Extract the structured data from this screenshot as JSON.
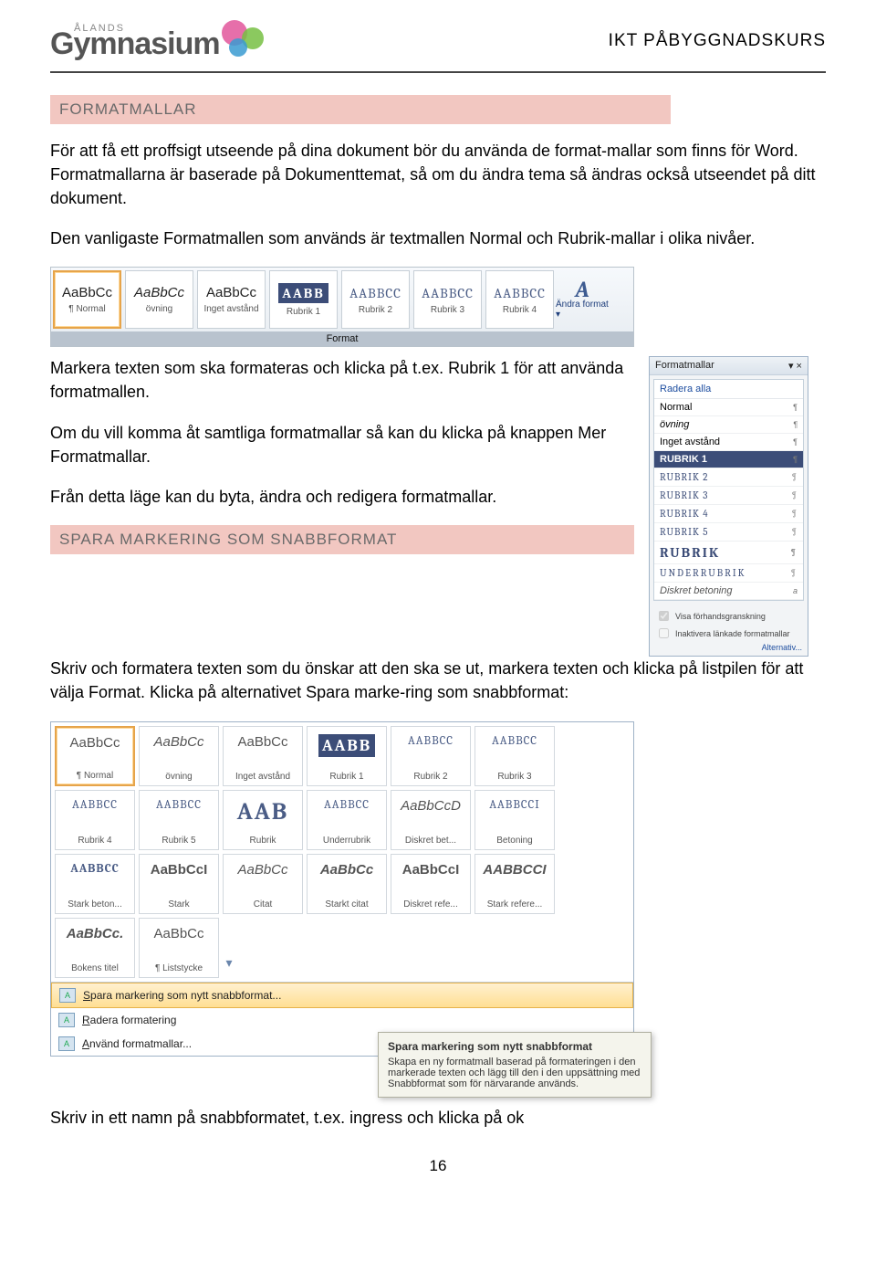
{
  "header": {
    "brand_top": "ÅLANDS",
    "brand": "Gymnasium",
    "course_title": "IKT PÅBYGGNADSKURS"
  },
  "sections": {
    "heading1": "FORMATMALLAR",
    "para1": "För att få ett proffsigt utseende på dina dokument bör du använda de format-mallar som finns för Word. Formatmallarna är baserade på Dokumenttemat, så om du ändra tema så ändras också utseendet på ditt dokument.",
    "para2": "Den vanligaste Formatmallen som används är textmallen Normal och Rubrik-mallar i olika nivåer.",
    "para3": "Markera texten som ska formateras och klicka på t.ex. Rubrik 1 för att använda formatmallen.",
    "para4": "Om du vill komma åt samtliga formatmallar så kan du klicka på knappen Mer Formatmallar.",
    "para5": "Från detta läge kan du byta, ändra och redigera formatmallar.",
    "heading2": "SPARA MARKERING SOM SNABBFORMAT",
    "para6": "Skriv och formatera texten som du önskar att den ska se ut, markera texten och klicka på listpilen för att välja Format. Klicka på alternativet Spara marke-ring som snabbformat:",
    "para7": "Skriv in ett namn på snabbformatet, t.ex. ingress och klicka på ok"
  },
  "ribbon": {
    "tiles": [
      {
        "sample": "AaBbCc",
        "label": "¶ Normal",
        "class": ""
      },
      {
        "sample": "AaBbCc",
        "label": "övning",
        "class": "italic"
      },
      {
        "sample": "AaBbCc",
        "label": "Inget avstånd",
        "class": ""
      },
      {
        "sample": "AABB",
        "label": "Rubrik 1",
        "class": "rubrik1"
      },
      {
        "sample": "AABBCC",
        "label": "Rubrik 2",
        "class": "rubrik"
      },
      {
        "sample": "AABBCC",
        "label": "Rubrik 3",
        "class": "rubrik"
      },
      {
        "sample": "AABBCC",
        "label": "Rubrik 4",
        "class": "rubrik"
      }
    ],
    "change_format": "Ändra format ▾",
    "footer": "Format"
  },
  "pane": {
    "title": "Formatmallar",
    "clear": "Radera alla",
    "items": [
      {
        "label": "Normal",
        "class": "",
        "mark": "¶"
      },
      {
        "label": "övning",
        "class": "italic",
        "mark": "¶"
      },
      {
        "label": "Inget avstånd",
        "class": "",
        "mark": "¶"
      },
      {
        "label": "RUBRIK 1",
        "class": "sel-rubrik1",
        "mark": "¶"
      },
      {
        "label": "RUBRIK 2",
        "class": "rubrik-n",
        "mark": "¶"
      },
      {
        "label": "RUBRIK 3",
        "class": "rubrik-n",
        "mark": "¶"
      },
      {
        "label": "RUBRIK 4",
        "class": "rubrik-n",
        "mark": "¶"
      },
      {
        "label": "RUBRIK 5",
        "class": "rubrik-n",
        "mark": "¶"
      },
      {
        "label": "RUBRIK",
        "class": "rubrik-l",
        "mark": "¶"
      },
      {
        "label": "UNDERRUBRIK",
        "class": "under",
        "mark": "¶"
      },
      {
        "label": "Diskret betoning",
        "class": "disk",
        "mark": "a"
      }
    ],
    "chk1": "Visa förhandsgranskning",
    "chk2": "Inaktivera länkade formatmallar",
    "alt": "Alternativ..."
  },
  "big_gallery": {
    "rows": [
      [
        {
          "sample": "AaBbCc",
          "label": "¶ Normal",
          "sel": true
        },
        {
          "sample": "AaBbCc",
          "label": "övning",
          "italic": true
        },
        {
          "sample": "AaBbCc",
          "label": "Inget avstånd"
        },
        {
          "sample": "AABB",
          "label": "Rubrik 1",
          "cls": "rubrik1"
        },
        {
          "sample": "AABBCC",
          "label": "Rubrik 2",
          "cls": "rubrik"
        },
        {
          "sample": "AABBCC",
          "label": "Rubrik 3",
          "cls": "rubrik"
        },
        {
          "sample": "AABBCC",
          "label": "Rubrik 4",
          "cls": "rubrik"
        }
      ],
      [
        {
          "sample": "AABBCC",
          "label": "Rubrik 5",
          "cls": "rubrik"
        },
        {
          "sample": "AAB",
          "label": "Rubrik",
          "cls": "rubrik-big"
        },
        {
          "sample": "AABBCC",
          "label": "Underrubrik",
          "cls": "rubrik"
        },
        {
          "sample": "AaBbCcD",
          "label": "Diskret bet...",
          "italic": true
        },
        {
          "sample": "AABBCCI",
          "label": "Betoning",
          "cls": "rubrik"
        },
        {
          "sample": "AABBCC",
          "label": "Stark beton...",
          "bold": true,
          "cls": "rubrik"
        },
        {
          "sample": "AaBbCcI",
          "label": "Stark",
          "bold": true
        }
      ],
      [
        {
          "sample": "AaBbCc",
          "label": "Citat",
          "italic": true
        },
        {
          "sample": "AaBbCc",
          "label": "Starkt citat",
          "italic": true,
          "bold": true
        },
        {
          "sample": "AaBbCcI",
          "label": "Diskret refe...",
          "bold": true
        },
        {
          "sample": "AABBCCI",
          "label": "Stark refere...",
          "bold": true,
          "italic": true
        },
        {
          "sample": "AaBbCc.",
          "label": "Bokens titel",
          "bold": true,
          "italic": true
        },
        {
          "sample": "AaBbCc",
          "label": "¶ Liststycke"
        }
      ]
    ],
    "menu": [
      {
        "label": "Spara markering som nytt snabbformat...",
        "highlight": true,
        "underline": "S"
      },
      {
        "label": "Radera formatering",
        "underline": "R"
      },
      {
        "label": "Använd formatmallar...",
        "underline": "A"
      }
    ]
  },
  "tooltip": {
    "title": "Spara markering som nytt snabbformat",
    "body": "Skapa en ny formatmall baserad på formateringen i den markerade texten och lägg till den i den uppsättning med Snabbformat som för närvarande används."
  },
  "page_number": "16"
}
